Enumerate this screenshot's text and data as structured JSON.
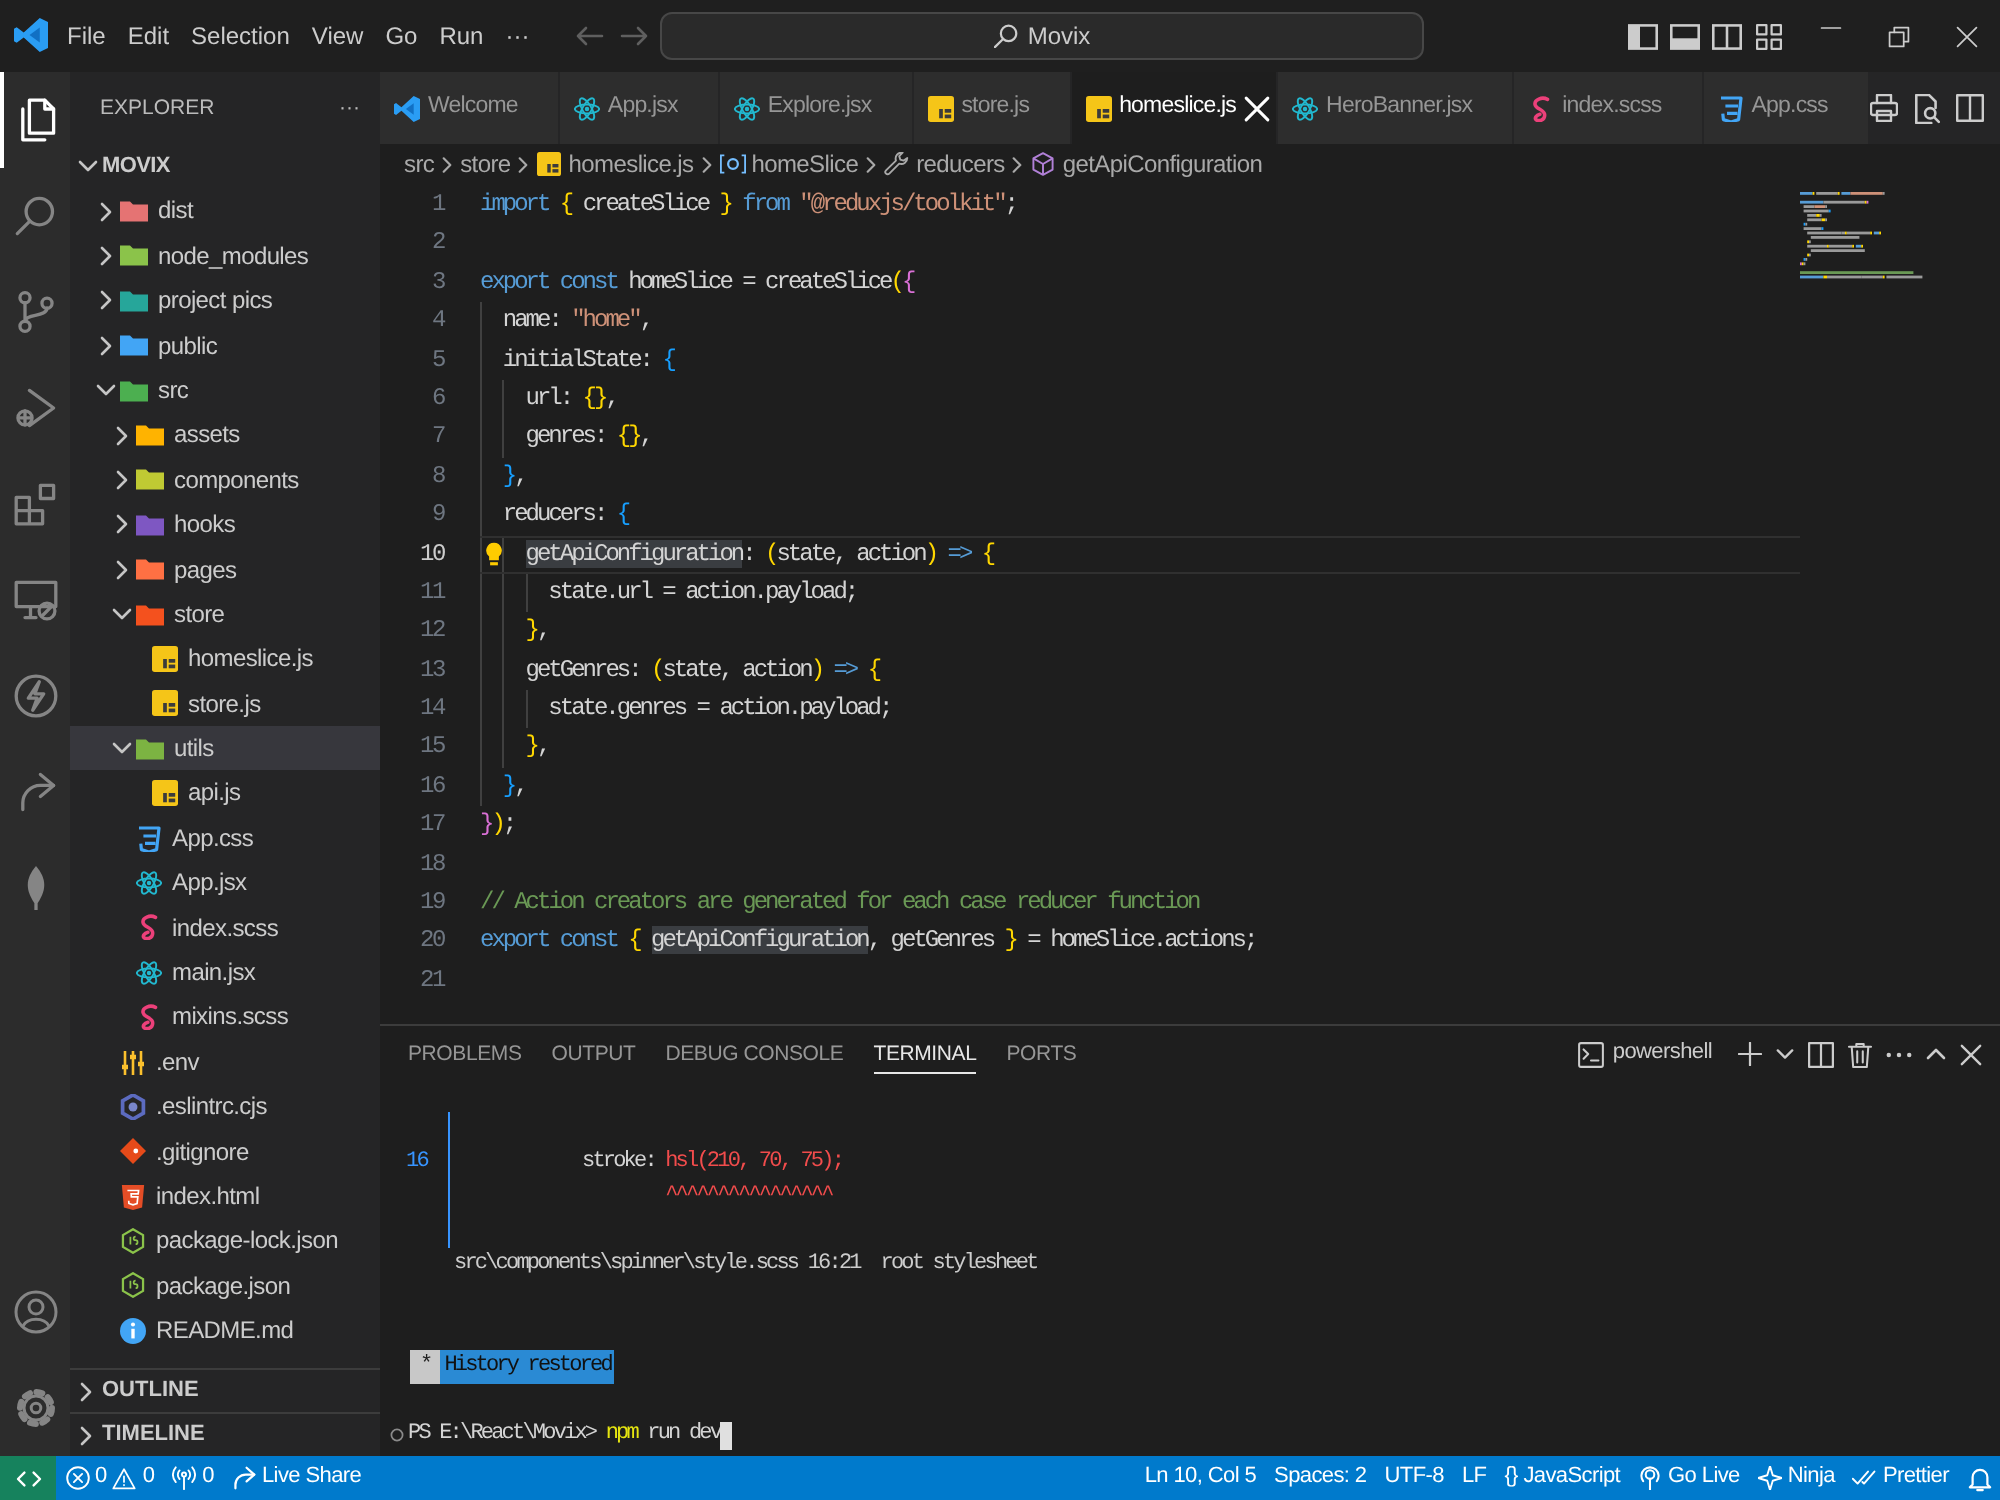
{
  "title_bar": {
    "menus": [
      "File",
      "Edit",
      "Selection",
      "View",
      "Go",
      "Run",
      "···"
    ],
    "navigation": [
      {
        "kind": "back",
        "disabled": true
      },
      {
        "kind": "forward",
        "disabled": true
      }
    ],
    "command_center": {
      "text": "Movix"
    }
  },
  "activity_bar": {
    "items": [
      {
        "kind": "files",
        "selected": true
      },
      {
        "kind": "search",
        "selected": false
      },
      {
        "kind": "branch",
        "selected": false
      },
      {
        "kind": "run",
        "selected": false
      },
      {
        "kind": "extensions",
        "selected": false
      },
      {
        "kind": "monitor",
        "selected": false
      },
      {
        "kind": "lightning",
        "selected": false
      },
      {
        "kind": "share",
        "selected": false
      },
      {
        "kind": "leaf",
        "selected": false
      }
    ],
    "bottom_items": [
      {
        "kind": "account"
      },
      {
        "kind": "gear"
      }
    ]
  },
  "sidebar": {
    "title": "EXPLORER",
    "more": "···",
    "root": {
      "label": "MOVIX",
      "expanded": true,
      "children": [
        {
          "label": "dist",
          "kind": "folder",
          "color": "#e57373",
          "expanded": false,
          "selected": false
        },
        {
          "label": "node_modules",
          "kind": "folder",
          "color": "#8bc34a",
          "expanded": false,
          "selected": false
        },
        {
          "label": "project pics",
          "kind": "folder",
          "color": "#26a69a",
          "expanded": false,
          "selected": false
        },
        {
          "label": "public",
          "kind": "folder",
          "color": "#42a5f5",
          "expanded": false,
          "selected": false
        },
        {
          "label": "src",
          "kind": "folder",
          "color": "#4caf50",
          "expanded": true,
          "selected": false,
          "children": [
            {
              "label": "assets",
              "kind": "folder",
              "color": "#ffb300",
              "expanded": false,
              "selected": false
            },
            {
              "label": "components",
              "kind": "folder",
              "color": "#c0ca33",
              "expanded": false,
              "selected": false
            },
            {
              "label": "hooks",
              "kind": "folder",
              "color": "#7e57c2",
              "expanded": false,
              "selected": false
            },
            {
              "label": "pages",
              "kind": "folder",
              "color": "#ff7043",
              "expanded": false,
              "selected": false
            },
            {
              "label": "store",
              "kind": "folder",
              "color": "#f4511e",
              "expanded": true,
              "selected": false,
              "children": [
                {
                  "label": "homeslice.js",
                  "kind": "js",
                  "selected": false
                },
                {
                  "label": "store.js",
                  "kind": "js",
                  "selected": false
                }
              ]
            },
            {
              "label": "utils",
              "kind": "folder",
              "color": "#7cb342",
              "expanded": true,
              "selected": true,
              "children": [
                {
                  "label": "api.js",
                  "kind": "js",
                  "selected": false
                }
              ]
            },
            {
              "label": "App.css",
              "kind": "css",
              "selected": false
            },
            {
              "label": "App.jsx",
              "kind": "react",
              "selected": false
            },
            {
              "label": "index.scss",
              "kind": "sass",
              "selected": false
            },
            {
              "label": "main.jsx",
              "kind": "react",
              "selected": false
            },
            {
              "label": "mixins.scss",
              "kind": "sass",
              "selected": false
            }
          ]
        },
        {
          "label": ".env",
          "kind": "env",
          "selected": false
        },
        {
          "label": ".eslintrc.cjs",
          "kind": "config",
          "selected": false
        },
        {
          "label": ".gitignore",
          "kind": "ignore",
          "selected": false
        },
        {
          "label": "index.html",
          "kind": "html",
          "selected": false
        },
        {
          "label": "package-lock.json",
          "kind": "package",
          "selected": false
        },
        {
          "label": "package.json",
          "kind": "package",
          "selected": false
        },
        {
          "label": "README.md",
          "kind": "readme",
          "selected": false
        }
      ]
    },
    "sections": [
      {
        "label": "OUTLINE",
        "expanded": false
      },
      {
        "label": "TIMELINE",
        "expanded": false
      }
    ]
  },
  "tabs": [
    {
      "label": "Welcome",
      "kind": "welcome",
      "selected": false
    },
    {
      "label": "App.jsx",
      "kind": "react",
      "selected": false
    },
    {
      "label": "Explore.jsx",
      "kind": "react",
      "selected": false
    },
    {
      "label": "store.js",
      "kind": "js",
      "selected": false
    },
    {
      "label": "homeslice.js",
      "kind": "js",
      "selected": true
    },
    {
      "label": "HeroBanner.jsx",
      "kind": "react",
      "selected": false
    },
    {
      "label": "index.scss",
      "kind": "sass",
      "selected": false
    },
    {
      "label": "App.css",
      "kind": "css",
      "selected": false
    }
  ],
  "breadcrumbs": [
    {
      "label": "src",
      "kind": "folder"
    },
    {
      "label": "store",
      "kind": "folder"
    },
    {
      "label": "homeslice.js",
      "kind": "js"
    },
    {
      "label": "homeSlice",
      "kind": "variable"
    },
    {
      "label": "reducers",
      "kind": "property"
    },
    {
      "label": "getApiConfiguration",
      "kind": "method"
    }
  ],
  "editor": {
    "lines": [
      {
        "n": "1",
        "current": false,
        "tokens": [
          {
            "text": "import ",
            "kind": "keyword"
          },
          {
            "text": "{",
            "kind": "bracket1"
          },
          {
            "text": " createSlice ",
            "kind": "plain"
          },
          {
            "text": "}",
            "kind": "bracket1"
          },
          {
            "text": " from ",
            "kind": "keyword"
          },
          {
            "text": "\"@reduxjs/toolkit\"",
            "kind": "string"
          },
          {
            "text": ";",
            "kind": "plain"
          }
        ]
      },
      {
        "n": "2",
        "current": false
      },
      {
        "n": "3",
        "current": false,
        "tokens": [
          {
            "text": "export const ",
            "kind": "keyword"
          },
          {
            "text": "homeSlice = createSlice",
            "kind": "plain"
          },
          {
            "text": "(",
            "kind": "bracket1"
          },
          {
            "text": "{",
            "kind": "bracket2"
          }
        ]
      },
      {
        "n": "4",
        "current": false,
        "tokens": [
          {
            "text": "  name: ",
            "kind": "plain"
          },
          {
            "text": "\"home\"",
            "kind": "string"
          },
          {
            "text": ",",
            "kind": "plain"
          }
        ]
      },
      {
        "n": "5",
        "current": false,
        "tokens": [
          {
            "text": "  initialState: ",
            "kind": "plain"
          },
          {
            "text": "{",
            "kind": "bracket3"
          }
        ]
      },
      {
        "n": "6",
        "current": false,
        "tokens": [
          {
            "text": "    url: ",
            "kind": "plain"
          },
          {
            "text": "{}",
            "kind": "bracket1"
          },
          {
            "text": ",",
            "kind": "plain"
          }
        ]
      },
      {
        "n": "7",
        "current": false,
        "tokens": [
          {
            "text": "    genres: ",
            "kind": "plain"
          },
          {
            "text": "{}",
            "kind": "bracket1"
          },
          {
            "text": ",",
            "kind": "plain"
          }
        ]
      },
      {
        "n": "8",
        "current": false,
        "tokens": [
          {
            "text": "  }",
            "kind": "bracket3"
          },
          {
            "text": ",",
            "kind": "plain"
          }
        ]
      },
      {
        "n": "9",
        "current": false,
        "tokens": [
          {
            "text": "  reducers: ",
            "kind": "plain"
          },
          {
            "text": "{",
            "kind": "bracket3"
          }
        ]
      },
      {
        "n": "10",
        "current": true,
        "tokens": [
          {
            "text": "    getApiConfiguration",
            "kind": "highlight"
          },
          {
            "text": ": ",
            "kind": "plain"
          },
          {
            "text": "(",
            "kind": "bracket1"
          },
          {
            "text": "state, action",
            "kind": "plain"
          },
          {
            "text": ")",
            "kind": "bracket1"
          },
          {
            "text": " => ",
            "kind": "keyword"
          },
          {
            "text": "{",
            "kind": "bracket1"
          }
        ]
      },
      {
        "n": "11",
        "current": false,
        "tokens": [
          {
            "text": "      state.url = action.payload;",
            "kind": "plain"
          }
        ]
      },
      {
        "n": "12",
        "current": false,
        "tokens": [
          {
            "text": "    }",
            "kind": "bracket1"
          },
          {
            "text": ",",
            "kind": "plain"
          }
        ]
      },
      {
        "n": "13",
        "current": false,
        "tokens": [
          {
            "text": "    getGenres: ",
            "kind": "plain"
          },
          {
            "text": "(",
            "kind": "bracket1"
          },
          {
            "text": "state, action",
            "kind": "plain"
          },
          {
            "text": ")",
            "kind": "bracket1"
          },
          {
            "text": " => ",
            "kind": "keyword"
          },
          {
            "text": "{",
            "kind": "bracket1"
          }
        ]
      },
      {
        "n": "14",
        "current": false,
        "tokens": [
          {
            "text": "      state.genres = action.payload;",
            "kind": "plain"
          }
        ]
      },
      {
        "n": "15",
        "current": false,
        "tokens": [
          {
            "text": "    }",
            "kind": "bracket1"
          },
          {
            "text": ",",
            "kind": "plain"
          }
        ]
      },
      {
        "n": "16",
        "current": false,
        "tokens": [
          {
            "text": "  }",
            "kind": "bracket3"
          },
          {
            "text": ",",
            "kind": "plain"
          }
        ]
      },
      {
        "n": "17",
        "current": false,
        "tokens": [
          {
            "text": "}",
            "kind": "bracket2"
          },
          {
            "text": ")",
            "kind": "bracket1"
          },
          {
            "text": ";",
            "kind": "plain"
          }
        ]
      },
      {
        "n": "18",
        "current": false
      },
      {
        "n": "19",
        "current": false,
        "tokens": [
          {
            "text": "// Action creators are generated for each case reducer function",
            "kind": "comment"
          }
        ]
      },
      {
        "n": "20",
        "current": false,
        "tokens": [
          {
            "text": "export const ",
            "kind": "keyword"
          },
          {
            "text": "{ ",
            "kind": "bracket1"
          },
          {
            "text": "getApiConfiguration",
            "kind": "highlight"
          },
          {
            "text": ", getGenres ",
            "kind": "plain"
          },
          {
            "text": "}",
            "kind": "bracket1"
          },
          {
            "text": " = homeSlice.actions;",
            "kind": "plain"
          }
        ]
      },
      {
        "n": "21",
        "current": false
      }
    ]
  },
  "panel": {
    "tabs": [
      {
        "label": "PROBLEMS",
        "selected": false
      },
      {
        "label": "OUTPUT",
        "selected": false
      },
      {
        "label": "DEBUG CONSOLE",
        "selected": false
      },
      {
        "label": "TERMINAL",
        "selected": true
      },
      {
        "label": "PORTS",
        "selected": false
      }
    ],
    "shell": "powershell",
    "terminal": {
      "lines": [
        {
          "kind": "source",
          "gutter": "16",
          "tokens": [
            {
              "text": "stroke: ",
              "kind": "plain"
            },
            {
              "text": "hsl(210, 70, 75);",
              "kind": "error"
            }
          ]
        },
        {
          "kind": "marker",
          "text": "^^^^^^^^^^^^^^^^"
        },
        {
          "kind": "text",
          "text": "src\\components\\spinner\\style.scss 16:21  root stylesheet"
        },
        {
          "kind": "notice",
          "mark": "*",
          "text": "History restored"
        },
        {
          "kind": "prompt",
          "tokens": [
            {
              "text": "PS E:\\React\\Movix> ",
              "kind": "plain"
            },
            {
              "text": "npm",
              "kind": "command"
            },
            {
              "text": " run dev",
              "kind": "plain"
            }
          ]
        }
      ]
    }
  },
  "status_bar": {
    "left": [
      {
        "kind": "remote"
      },
      {
        "kind": "problems",
        "errors": "0",
        "warnings": "0"
      },
      {
        "kind": "ports",
        "text": "0"
      },
      {
        "kind": "liveshare",
        "text": "Live Share"
      }
    ],
    "right": [
      {
        "kind": "position",
        "text": "Ln 10, Col 5"
      },
      {
        "kind": "indent",
        "text": "Spaces: 2"
      },
      {
        "kind": "encoding",
        "text": "UTF-8"
      },
      {
        "kind": "eol",
        "text": "LF"
      },
      {
        "kind": "language",
        "text": "{} JavaScript"
      },
      {
        "kind": "golive",
        "text": "Go Live"
      },
      {
        "kind": "ninja",
        "text": "Ninja"
      },
      {
        "kind": "prettier",
        "text": "Prettier"
      },
      {
        "kind": "bell"
      }
    ]
  }
}
